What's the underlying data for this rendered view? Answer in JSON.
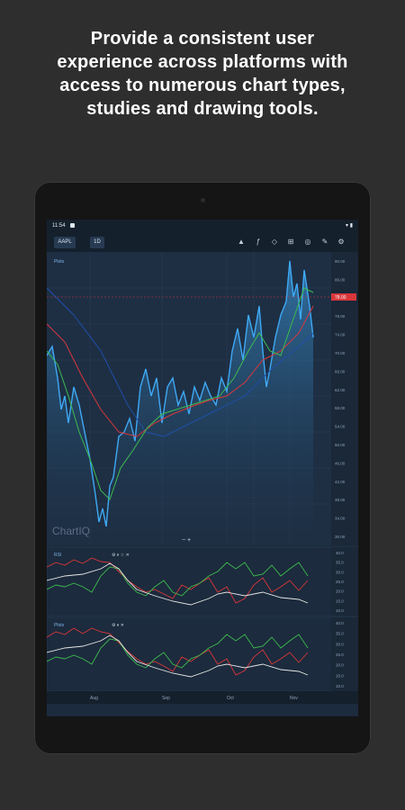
{
  "headline": {
    "line1": "Provide a consistent user",
    "line2": "experience across platforms with",
    "line3": "access to numerous chart types,",
    "line4": "studies and drawing tools."
  },
  "status_bar": {
    "time": "11:54",
    "icons": "▾ ▮"
  },
  "toolbar": {
    "symbol": "AAPL",
    "interval": "1D",
    "icons": [
      "chart-type-icon",
      "studies-icon",
      "drawing-icon",
      "crosshair-icon",
      "layers-icon",
      "pencil-icon",
      "settings-icon"
    ]
  },
  "main_panel": {
    "legend": "Plots",
    "watermark": "ChartIQ",
    "current_price_label": "78.00",
    "y_labels": [
      "90.00",
      "86.00",
      "82.00",
      "78.00",
      "74.00",
      "70.00",
      "66.00",
      "62.00",
      "58.00",
      "54.00",
      "50.00",
      "46.00",
      "42.00",
      "38.00",
      "34.00",
      "30.00"
    ]
  },
  "study_panel_1": {
    "legend": "RSI",
    "y_labels": [
      "40.0",
      "35.0",
      "30.0",
      "25.0",
      "20.0",
      "15.0",
      "10.0"
    ]
  },
  "study_panel_2": {
    "legend": "Plots",
    "y_labels": [
      "40.0",
      "35.0",
      "30.0",
      "25.0",
      "20.0",
      "15.0",
      "10.0"
    ]
  },
  "x_axis": {
    "labels": [
      "Aug",
      "Sep",
      "Oct",
      "Nov"
    ]
  },
  "colors": {
    "background": "#2e2e2e",
    "screen": "#1c2b3d",
    "price_line": "#3fa9f5",
    "ma_green": "#3dbb4f",
    "ma_red": "#d9373b",
    "ma_blue": "#1f4fa8",
    "study_white": "#e6e6e6"
  }
}
